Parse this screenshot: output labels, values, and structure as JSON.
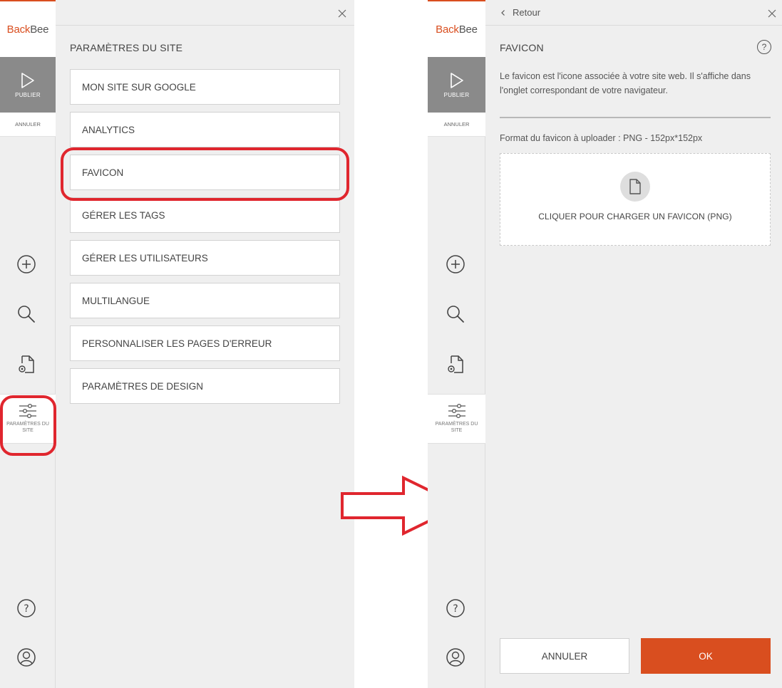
{
  "brand": {
    "logo_part1": "Back",
    "logo_part2": "Bee",
    "accent": "#d94e1f",
    "highlight": "#e0262e"
  },
  "sidebar": {
    "publish_label": "PUBLIER",
    "cancel_label": "ANNULER",
    "settings_label": "PARAMÈTRES DU SITE",
    "icons": [
      "play-icon",
      "add-icon",
      "search-icon",
      "page-settings-icon",
      "sliders-icon",
      "help-icon",
      "user-icon"
    ]
  },
  "left_panel": {
    "title": "PARAMÈTRES DU SITE",
    "items": [
      {
        "label": "MON SITE SUR GOOGLE"
      },
      {
        "label": "ANALYTICS"
      },
      {
        "label": "FAVICON"
      },
      {
        "label": "GÉRER LES TAGS"
      },
      {
        "label": "GÉRER LES UTILISATEURS"
      },
      {
        "label": "MULTILANGUE"
      },
      {
        "label": "PERSONNALISER LES PAGES D'ERREUR"
      },
      {
        "label": "PARAMÈTRES DE DESIGN"
      }
    ]
  },
  "right_panel": {
    "back_label": "Retour",
    "title": "FAVICON",
    "help_glyph": "?",
    "description": "Le favicon est l'icone associée à votre site web. Il s'affiche dans l'onglet correspondant de votre navigateur.",
    "format_text": "Format du favicon à uploader : PNG - 152px*152px",
    "upload_label": "CLIQUER POUR CHARGER UN FAVICON (PNG)",
    "cancel_label": "ANNULER",
    "ok_label": "OK"
  }
}
